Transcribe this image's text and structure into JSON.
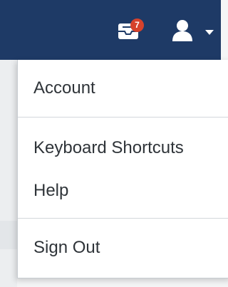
{
  "header": {
    "notifications_count": "7",
    "mail_icon": "mail-icon",
    "user_icon": "user-icon",
    "caret_icon": "caret-down-icon",
    "colors": {
      "bar": "#1e3a66",
      "badge": "#d6422c"
    }
  },
  "menu": {
    "items": [
      {
        "label": "Account"
      },
      {
        "label": "Keyboard Shortcuts"
      },
      {
        "label": "Help"
      },
      {
        "label": "Sign Out"
      }
    ]
  }
}
